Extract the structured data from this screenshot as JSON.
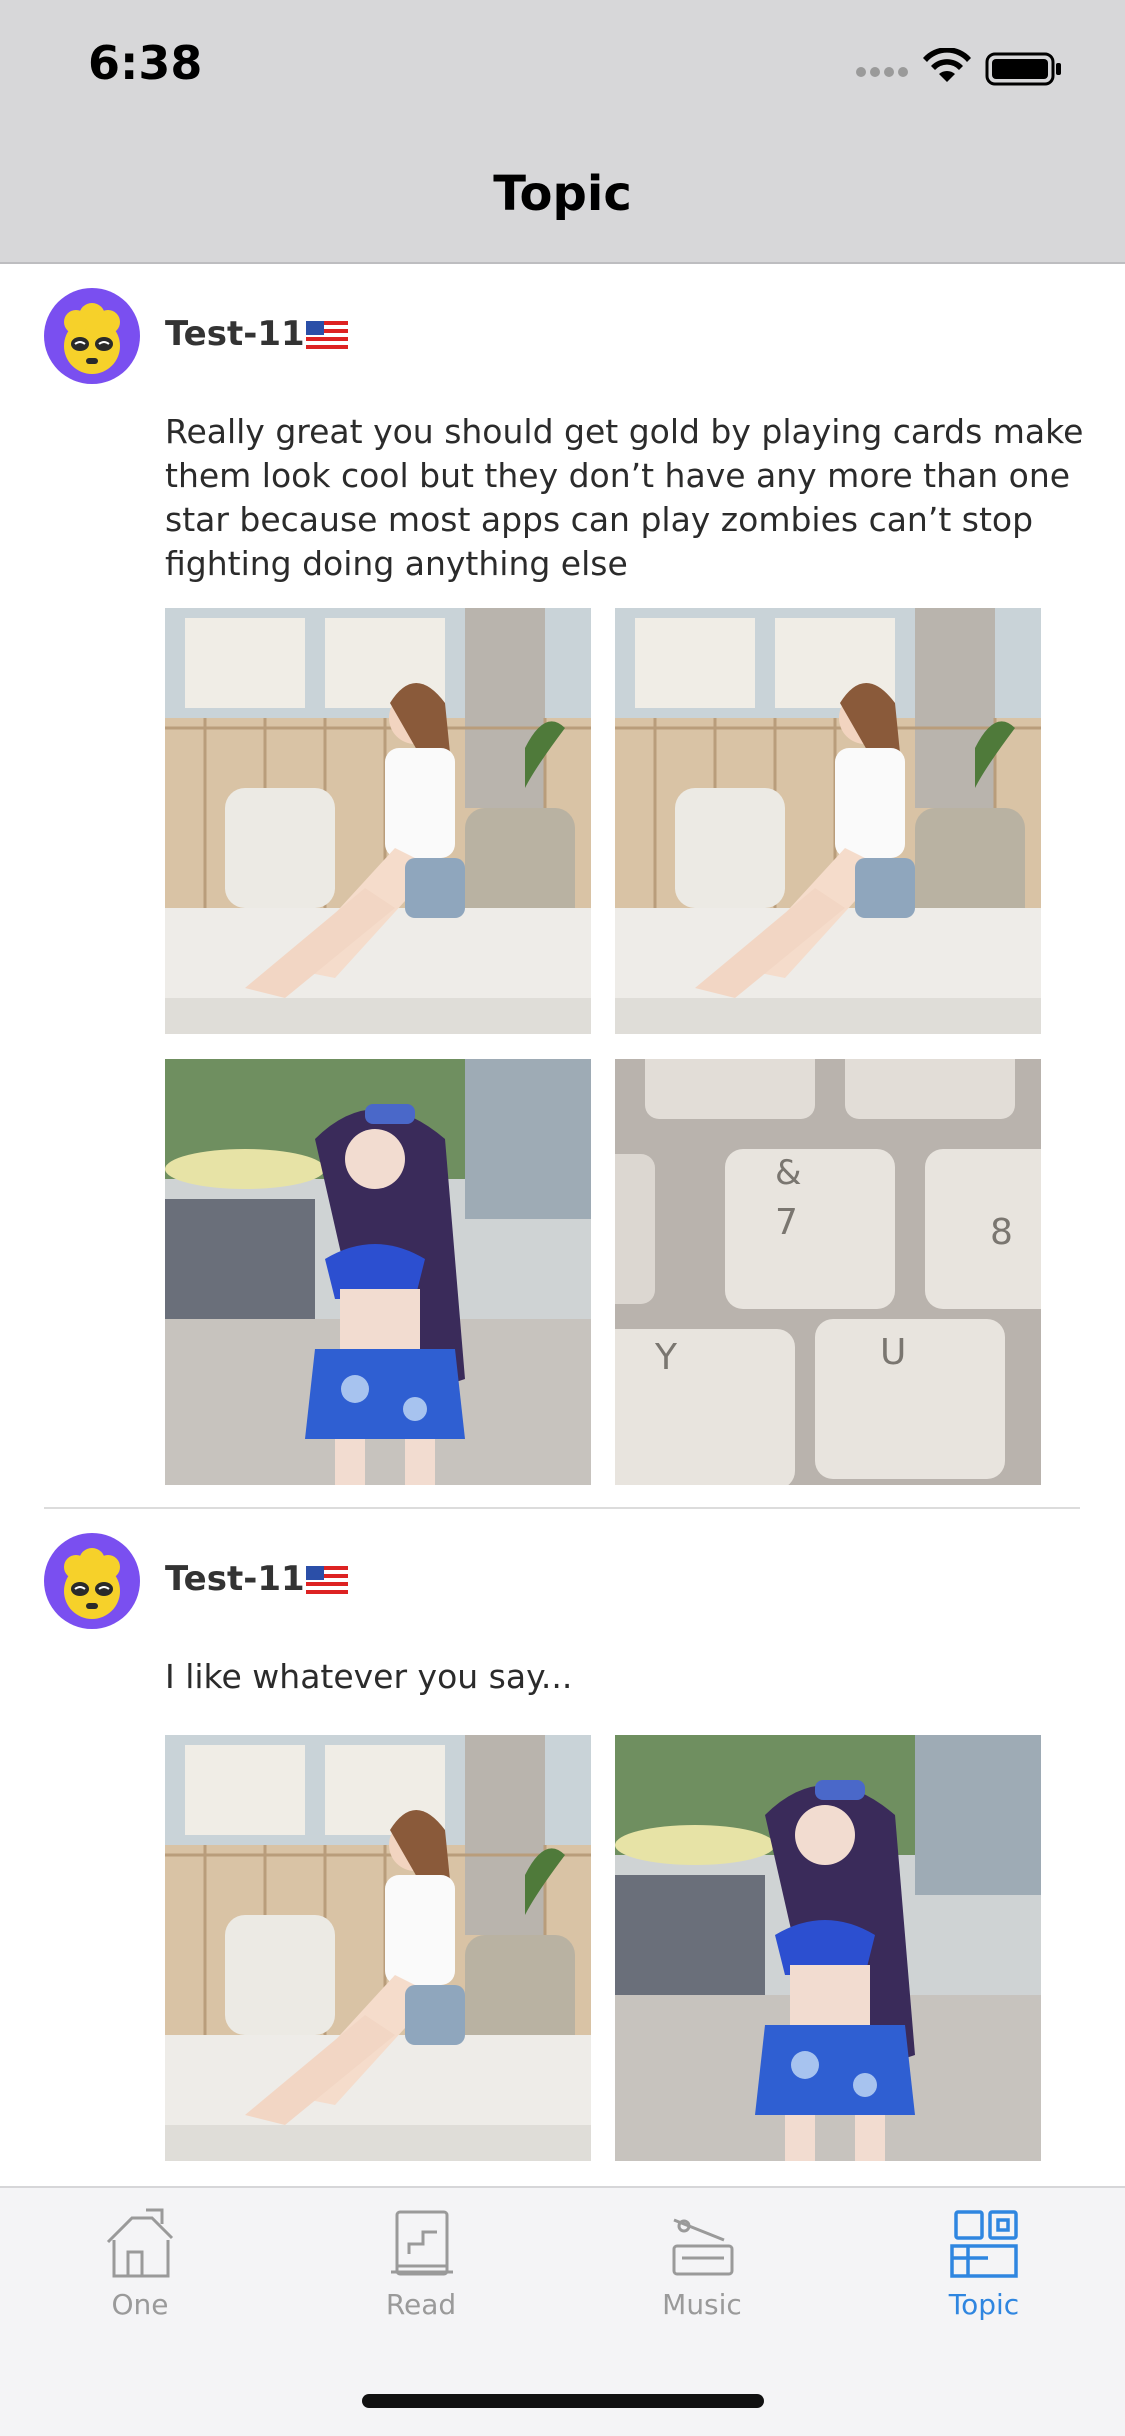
{
  "status_bar": {
    "time": "6:38"
  },
  "nav": {
    "title": "Topic"
  },
  "posts": [
    {
      "username": "Test-11",
      "flag": "us-flag",
      "text": "Really great you should get gold by playing cards make them look cool but they don’t have any more than one star because most apps can play zombies can’t stop fighting doing anything else",
      "photos": [
        "photo-girl-on-sofa",
        "photo-girl-on-sofa",
        "photo-cosplay-blue",
        "photo-keyboard-keys"
      ]
    },
    {
      "username": "Test-11",
      "flag": "us-flag",
      "text": "I like whatever you say...",
      "photos": [
        "photo-girl-on-sofa",
        "photo-cosplay-blue"
      ]
    }
  ],
  "tabs": [
    {
      "label": "One",
      "icon": "house-icon",
      "active": false
    },
    {
      "label": "Read",
      "icon": "book-icon",
      "active": false
    },
    {
      "label": "Music",
      "icon": "gramophone-icon",
      "active": false
    },
    {
      "label": "Topic",
      "icon": "topic-icon",
      "active": true
    }
  ],
  "colors": {
    "accent": "#2f86e0",
    "bar_bg": "#d7d7d9",
    "avatar_bg": "#7a4ff0"
  }
}
